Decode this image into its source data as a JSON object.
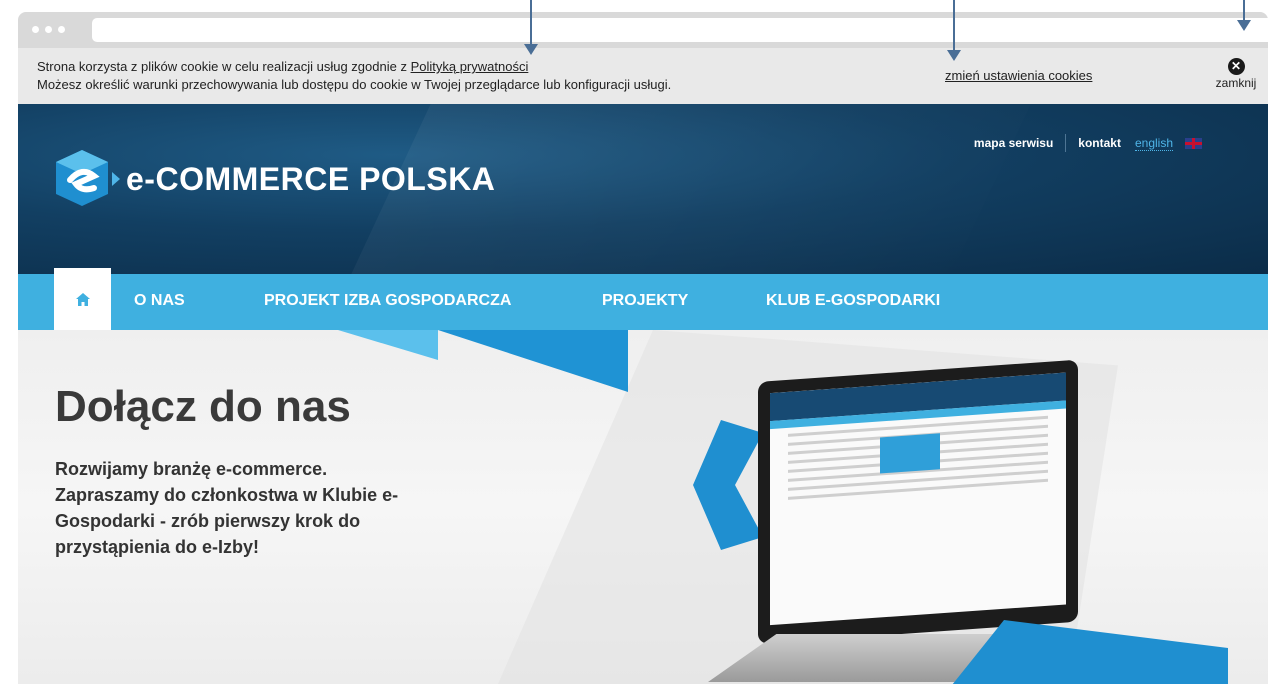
{
  "cookie_bar": {
    "line1_prefix": "Strona korzysta z plików cookie w celu realizacji usług zgodnie z ",
    "privacy_link": "Polityką prywatności",
    "line2": "Możesz określić warunki przechowywania lub dostępu do cookie w Twojej przeglądarce lub konfiguracji usługi.",
    "settings_link": "zmień ustawienia cookies",
    "close_label": "zamknij"
  },
  "header": {
    "brand": "e-COMMERCE POLSKA",
    "top_links": [
      "mapa serwisu",
      "kontakt",
      "english"
    ]
  },
  "nav": {
    "items": [
      "O NAS",
      "PROJEKT IZBA GOSPODARCZA",
      "PROJEKTY",
      "KLUB E-GOSPODARKI"
    ]
  },
  "hero": {
    "title": "Dołącz do nas",
    "text": "Rozwijamy branżę e-commerce. Zapraszamy do członkostwa w Klubie e-Gospodarki - zrób pierwszy krok do przystąpienia do e-Izby!"
  },
  "colors": {
    "header_dark": "#0b2c48",
    "nav_blue": "#3fb0e0",
    "accent": "#1f8fd0",
    "annotation_arrow": "#4a6e96"
  },
  "icons": [
    "close-icon",
    "home-icon",
    "uk-flag-icon",
    "logo-icon"
  ]
}
